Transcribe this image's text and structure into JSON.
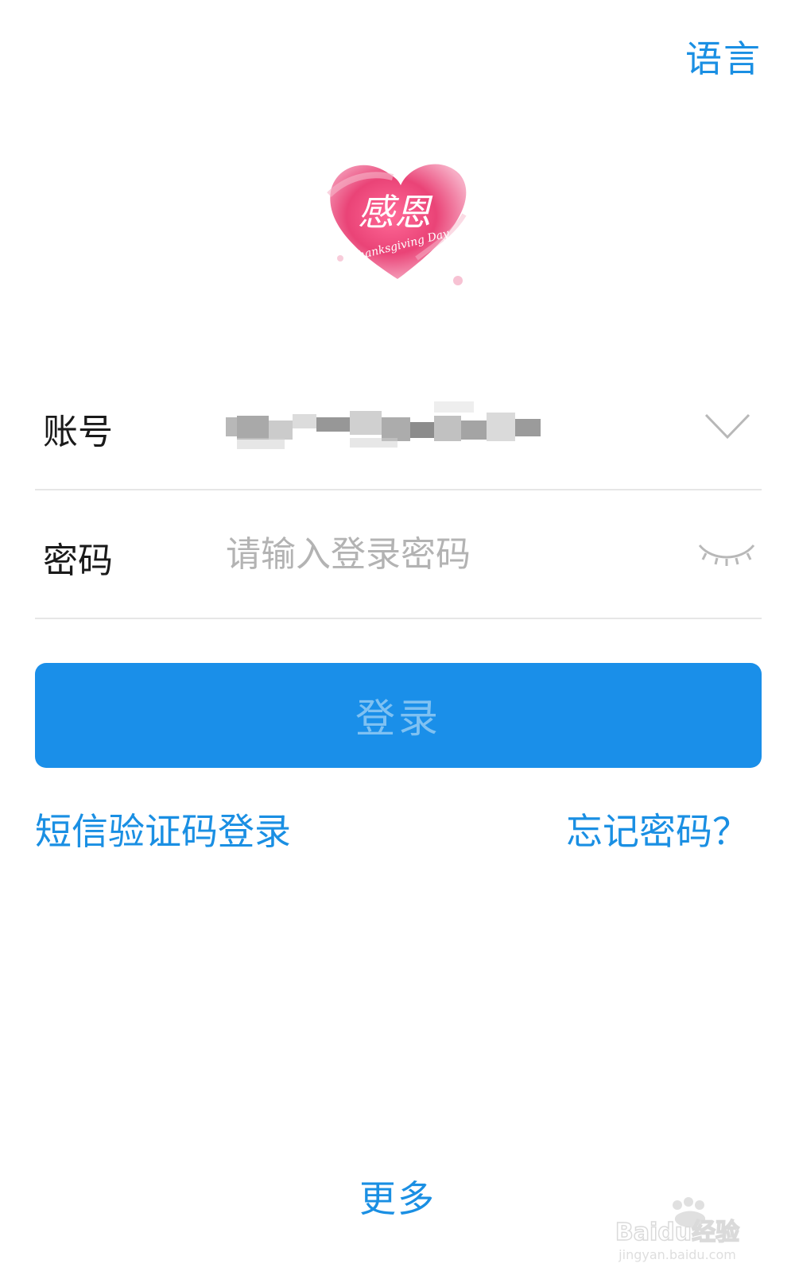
{
  "header": {
    "language_label": "语言"
  },
  "profile": {
    "avatar_text_main": "感恩",
    "avatar_text_sub": "Thanksgiving Day"
  },
  "form": {
    "account_label": "账号",
    "account_value": "",
    "password_label": "密码",
    "password_placeholder": "请输入登录密码",
    "password_value": ""
  },
  "actions": {
    "login_label": "登录",
    "sms_login_label": "短信验证码登录",
    "forgot_password_label": "忘记密码？",
    "more_label": "更多"
  },
  "watermark": {
    "brand": "Baidu经验",
    "url": "jingyan.baidu.com"
  },
  "colors": {
    "accent": "#1a8fe3",
    "button_bg": "#1a8fe9",
    "button_text_disabled": "#7fc1f2",
    "placeholder": "#b3b3b3",
    "divider": "#e6e6e6"
  },
  "icons": {
    "account_dropdown": "chevron-down-icon",
    "password_visibility": "eye-closed-icon"
  }
}
